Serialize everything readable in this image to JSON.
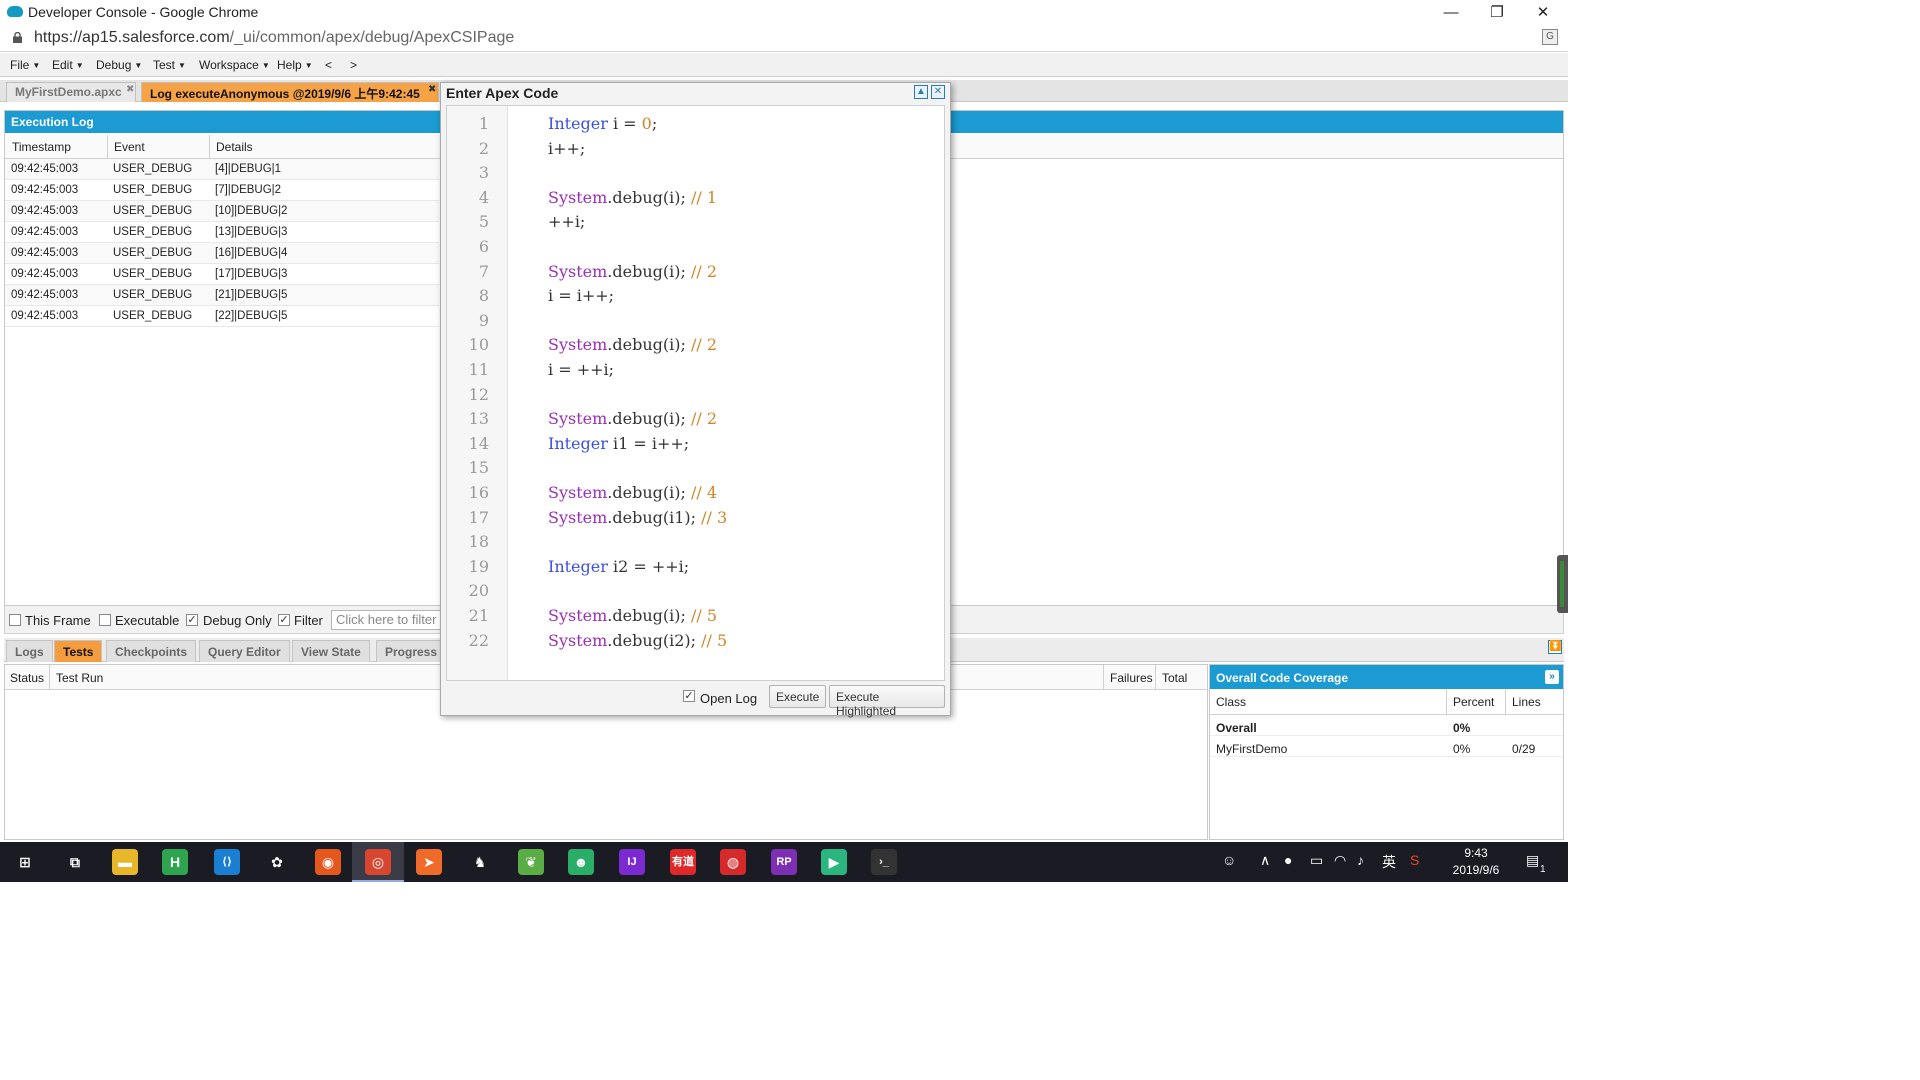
{
  "window": {
    "title": "Developer Console - Google Chrome",
    "minimize": "—",
    "restore": "❐",
    "close": "✕"
  },
  "address": {
    "url_host": "https://ap15.salesforce.com",
    "url_path": "/_ui/common/apex/debug/ApexCSIPage"
  },
  "menu": {
    "items": [
      "File",
      "Edit",
      "Debug",
      "Test",
      "Workspace",
      "Help",
      "<",
      ">"
    ]
  },
  "doc_tabs": [
    {
      "label": "MyFirstDemo.apxc",
      "active": false
    },
    {
      "label": "Log executeAnonymous @2019/9/6 上午9:42:45",
      "active": true
    }
  ],
  "exec_log": {
    "title": "Execution Log",
    "columns": [
      "Timestamp",
      "Event",
      "Details"
    ],
    "rows": [
      [
        "09:42:45:003",
        "USER_DEBUG",
        "[4]|DEBUG|1"
      ],
      [
        "09:42:45:003",
        "USER_DEBUG",
        "[7]|DEBUG|2"
      ],
      [
        "09:42:45:003",
        "USER_DEBUG",
        "[10]|DEBUG|2"
      ],
      [
        "09:42:45:003",
        "USER_DEBUG",
        "[13]|DEBUG|3"
      ],
      [
        "09:42:45:003",
        "USER_DEBUG",
        "[16]|DEBUG|4"
      ],
      [
        "09:42:45:003",
        "USER_DEBUG",
        "[17]|DEBUG|3"
      ],
      [
        "09:42:45:003",
        "USER_DEBUG",
        "[21]|DEBUG|5"
      ],
      [
        "09:42:45:003",
        "USER_DEBUG",
        "[22]|DEBUG|5"
      ]
    ]
  },
  "filters": {
    "this_frame": {
      "label": "This Frame",
      "checked": false
    },
    "executable": {
      "label": "Executable",
      "checked": false
    },
    "debug_only": {
      "label": "Debug Only",
      "checked": true
    },
    "filter": {
      "label": "Filter",
      "checked": true
    },
    "filter_placeholder": "Click here to filter the log"
  },
  "bottom_tabs": [
    "Logs",
    "Tests",
    "Checkpoints",
    "Query Editor",
    "View State",
    "Progress"
  ],
  "bottom_active": "Tests",
  "tests": {
    "columns": [
      "Status",
      "Test Run"
    ],
    "right_columns": [
      "Failures",
      "Total"
    ]
  },
  "coverage": {
    "title": "Overall Code Coverage",
    "columns": [
      "Class",
      "Percent",
      "Lines"
    ],
    "rows": [
      {
        "class": "Overall",
        "percent": "0%",
        "lines": "",
        "bold": true
      },
      {
        "class": "MyFirstDemo",
        "percent": "0%",
        "lines": "0/29",
        "bold": false
      }
    ]
  },
  "modal": {
    "title": "Enter Apex Code",
    "open_log": {
      "label": "Open Log",
      "checked": true
    },
    "execute_label": "Execute",
    "execute_highlighted_label": "Execute Highlighted",
    "code_lines": [
      [
        [
          "kw",
          "Integer"
        ],
        [
          "t",
          " i = "
        ],
        [
          "num",
          "0"
        ],
        [
          "t",
          ";"
        ]
      ],
      [
        [
          "t",
          "i++;"
        ]
      ],
      [],
      [
        [
          "cls",
          "System"
        ],
        [
          "t",
          ".debug(i); "
        ],
        [
          "cmt",
          "// 1"
        ]
      ],
      [
        [
          "t",
          "++i;"
        ]
      ],
      [],
      [
        [
          "cls",
          "System"
        ],
        [
          "t",
          ".debug(i); "
        ],
        [
          "cmt",
          "// 2"
        ]
      ],
      [
        [
          "t",
          "i = i++;"
        ]
      ],
      [],
      [
        [
          "cls",
          "System"
        ],
        [
          "t",
          ".debug(i); "
        ],
        [
          "cmt",
          "// 2"
        ]
      ],
      [
        [
          "t",
          "i = ++i;"
        ]
      ],
      [],
      [
        [
          "cls",
          "System"
        ],
        [
          "t",
          ".debug(i); "
        ],
        [
          "cmt",
          "// 2"
        ]
      ],
      [
        [
          "kw",
          "Integer"
        ],
        [
          "t",
          " i1 = i++;"
        ]
      ],
      [],
      [
        [
          "cls",
          "System"
        ],
        [
          "t",
          ".debug(i); "
        ],
        [
          "cmt",
          "// 4"
        ]
      ],
      [
        [
          "cls",
          "System"
        ],
        [
          "t",
          ".debug(i1); "
        ],
        [
          "cmt",
          "// 3"
        ]
      ],
      [],
      [
        [
          "kw",
          "Integer"
        ],
        [
          "t",
          " i2 = ++i;"
        ]
      ],
      [],
      [
        [
          "cls",
          "System"
        ],
        [
          "t",
          ".debug(i); "
        ],
        [
          "cmt",
          "// 5"
        ]
      ],
      [
        [
          "cls",
          "System"
        ],
        [
          "t",
          ".debug(i2); "
        ],
        [
          "cmt",
          "// 5"
        ]
      ]
    ]
  },
  "taskbar": {
    "apps": [
      {
        "name": "start-icon",
        "glyph": "⊞",
        "color": "transparent"
      },
      {
        "name": "task-view-icon",
        "glyph": "⧉",
        "color": "transparent"
      },
      {
        "name": "file-explorer-icon",
        "glyph": "▬",
        "color": "#e8b629"
      },
      {
        "name": "hbuilder-icon",
        "glyph": "H",
        "color": "#2ea44f"
      },
      {
        "name": "vscode-icon",
        "glyph": "⟨⟩",
        "color": "#1b7fd1"
      },
      {
        "name": "app-icon-6",
        "glyph": "✿",
        "color": "transparent"
      },
      {
        "name": "firefox-icon",
        "glyph": "◉",
        "color": "#e5571c"
      },
      {
        "name": "chrome-icon",
        "glyph": "◎",
        "color": "#d8462f"
      },
      {
        "name": "safari-like-icon",
        "glyph": "➤",
        "color": "#f06a2a"
      },
      {
        "name": "app-icon-10",
        "glyph": "♞",
        "color": "transparent"
      },
      {
        "name": "spring-icon",
        "glyph": "❦",
        "color": "#5aad45"
      },
      {
        "name": "wechat-icon",
        "glyph": "☻",
        "color": "#2aae67"
      },
      {
        "name": "intellij-icon",
        "glyph": "IJ",
        "color": "#7b2ad1"
      },
      {
        "name": "youdao-icon",
        "glyph": "有道",
        "color": "#e0282a"
      },
      {
        "name": "netease-music-icon",
        "glyph": "◍",
        "color": "#d62a2a"
      },
      {
        "name": "axure-rp-icon",
        "glyph": "RP",
        "color": "#7d2fb3"
      },
      {
        "name": "media-player-icon",
        "glyph": "▶",
        "color": "#2bb57f"
      },
      {
        "name": "terminal-icon",
        "glyph": "›_",
        "color": "#333"
      }
    ],
    "ime": "英",
    "time": "9:43",
    "date": "2019/9/6",
    "notif_count": "1"
  }
}
